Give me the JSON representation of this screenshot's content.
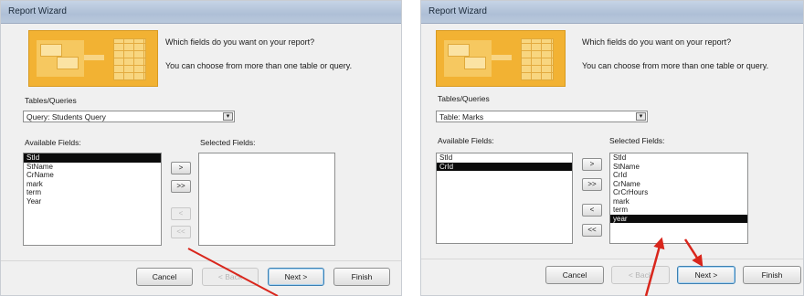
{
  "left": {
    "title": "Report Wizard",
    "prompt_line1": "Which fields do you want on your report?",
    "prompt_line2": "You can choose from more than one table or query.",
    "tables_label": "Tables/Queries",
    "tables_value": "Query: Students Query",
    "available_label": "Available Fields:",
    "selected_label": "Selected Fields:",
    "available_fields": [
      "StId",
      "StName",
      "CrName",
      "mark",
      "term",
      "Year"
    ],
    "selected_fields": [],
    "move_buttons": [
      ">",
      ">>",
      "<",
      "<<"
    ],
    "cancel": "Cancel",
    "back": "< Back",
    "next": "Next >",
    "finish": "Finish"
  },
  "right": {
    "title": "Report Wizard",
    "prompt_line1": "Which fields do you want on your report?",
    "prompt_line2": "You can choose from more than one table or query.",
    "tables_label": "Tables/Queries",
    "tables_value": "Table: Marks",
    "available_label": "Available Fields:",
    "selected_label": "Selected Fields:",
    "available_fields": [
      "StId",
      "CrId"
    ],
    "selected_fields": [
      "StId",
      "StName",
      "CrId",
      "CrName",
      "CrCrHours",
      "mark",
      "term",
      "year"
    ],
    "move_buttons": [
      ">",
      ">>",
      "<",
      "<<"
    ],
    "cancel": "Cancel",
    "back": "< Back",
    "next": "Next >",
    "finish": "Finish"
  },
  "colors": {
    "arrow": "#d9261c",
    "selection": "#0b0b0b",
    "banner": "#f2b233"
  }
}
